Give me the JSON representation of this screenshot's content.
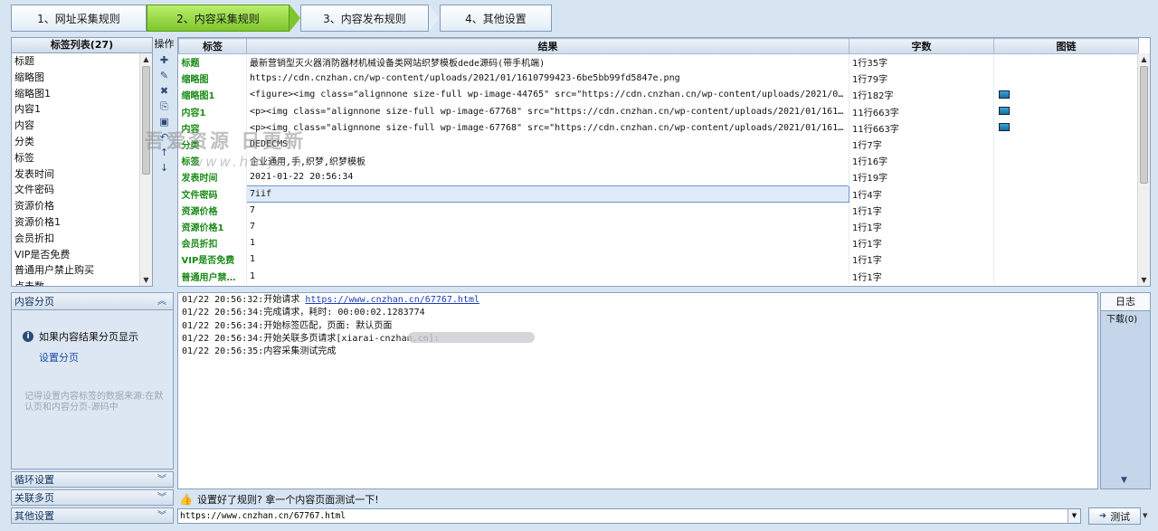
{
  "steps": [
    {
      "label": "1、网址采集规则",
      "active": false
    },
    {
      "label": "2、内容采集规则",
      "active": true
    },
    {
      "label": "3、内容发布规则",
      "active": false
    },
    {
      "label": "4、其他设置",
      "active": false
    }
  ],
  "tag_list": {
    "header": "标签列表(27)",
    "items": [
      "标题",
      "缩略图",
      "缩略图1",
      "内容1",
      "内容",
      "分类",
      "标签",
      "发表时间",
      "文件密码",
      "资源价格",
      "资源价格1",
      "会员折扣",
      "VIP是否免费",
      "普通用户禁止购买",
      "点击数"
    ]
  },
  "ops": {
    "title": "操作",
    "buttons": [
      {
        "name": "add-icon",
        "glyph": "✚"
      },
      {
        "name": "edit-icon",
        "glyph": "✎"
      },
      {
        "name": "delete-icon",
        "glyph": "✖"
      },
      {
        "name": "copy-icon",
        "glyph": "⎘"
      },
      {
        "name": "paste-icon",
        "glyph": "▣"
      },
      {
        "name": "undo-icon",
        "glyph": "↶"
      },
      {
        "name": "move-up-icon",
        "glyph": "↑"
      },
      {
        "name": "move-down-icon",
        "glyph": "↓"
      }
    ]
  },
  "results": {
    "columns": [
      "标签",
      "结果",
      "字数",
      "图链"
    ],
    "rows": [
      {
        "label": "标题",
        "result": "最新营销型灭火器消防器材机械设备类网站织梦模板dede源码(带手机端)",
        "count": "1行35字",
        "pic": false
      },
      {
        "label": "缩略图",
        "result": "https://cdn.cnzhan.cn/wp-content/uploads/2021/01/1610799423-6be5bb99fd5847e.png",
        "count": "1行79字",
        "pic": false
      },
      {
        "label": "缩略图1",
        "result": "<figure><img class=\"alignnone size-full wp-image-44765\" src=\"https://cdn.cnzhan.cn/wp-content/uploads/2021/01/1610799423-6be5bb99...",
        "count": "1行182字",
        "pic": true
      },
      {
        "label": "内容1",
        "result": "<p><img class=\"alignnone size-full wp-image-67768\" src=\"https://cdn.cnzhan.cn/wp-content/uploads/2021/01/1610799423-6be5bb99fd584...",
        "count": "11行663字",
        "pic": true
      },
      {
        "label": "内容",
        "result": "<p><img class=\"alignnone size-full wp-image-67768\" src=\"https://cdn.cnzhan.cn/wp-content/uploads/2021/01/1610799423-6be5bb99fd584...",
        "count": "11行663字",
        "pic": true
      },
      {
        "label": "分类",
        "result": "DEDECMS",
        "count": "1行7字",
        "pic": false
      },
      {
        "label": "标签",
        "result": "企业通用,手,织梦,织梦模板",
        "count": "1行16字",
        "pic": false
      },
      {
        "label": "发表时间",
        "result": "2021-01-22 20:56:34",
        "count": "1行19字",
        "pic": false
      },
      {
        "label": "文件密码",
        "result": "7iif",
        "count": "1行4字",
        "pic": false
      },
      {
        "label": "资源价格",
        "result": "7",
        "count": "1行1字",
        "pic": false
      },
      {
        "label": "资源价格1",
        "result": "7",
        "count": "1行1字",
        "pic": false
      },
      {
        "label": "会员折扣",
        "result": "1",
        "count": "1行1字",
        "pic": false
      },
      {
        "label": "VIP是否免费",
        "result": "1",
        "count": "1行1字",
        "pic": false
      },
      {
        "label": "普通用户禁…",
        "result": "1",
        "count": "1行1字",
        "pic": false
      }
    ],
    "selected_row": 8,
    "more_button": "..."
  },
  "paging": {
    "header": "内容分页",
    "info": "如果内容结果分页显示",
    "link": "设置分页",
    "note": "记得设置内容标签的数据来源:在默认页和内容分页-源码中"
  },
  "collapsed_sections": [
    "循环设置",
    "关联多页",
    "其他设置"
  ],
  "log": {
    "lines": [
      {
        "time": "01/22 20:56:32",
        "text": "开始请求 ",
        "link": "https://www.cnzhan.cn/67767.html"
      },
      {
        "time": "01/22 20:56:34",
        "text": "完成请求，耗时: 00:00:02.1283774",
        "link": ""
      },
      {
        "time": "01/22 20:56:34",
        "text": "开始标签匹配，页面: 默认页面",
        "link": ""
      },
      {
        "time": "01/22 20:56:34",
        "text": "开始关联多页请求[xiarai-cnzhan.cn]:",
        "link": ""
      },
      {
        "time": "01/22 20:56:35",
        "text": "内容采集测试完成",
        "link": ""
      }
    ]
  },
  "side_tabs": {
    "log": "日志",
    "download": "下载(0)"
  },
  "hint": "设置好了规则? 拿一个内容页面测试一下!",
  "url_input": {
    "value": "https://www.cnzhan.cn/67767.html"
  },
  "test_button": "测试",
  "watermark": {
    "line1": "吾爱资源 日更新",
    "line2": "www.huijo.n"
  }
}
